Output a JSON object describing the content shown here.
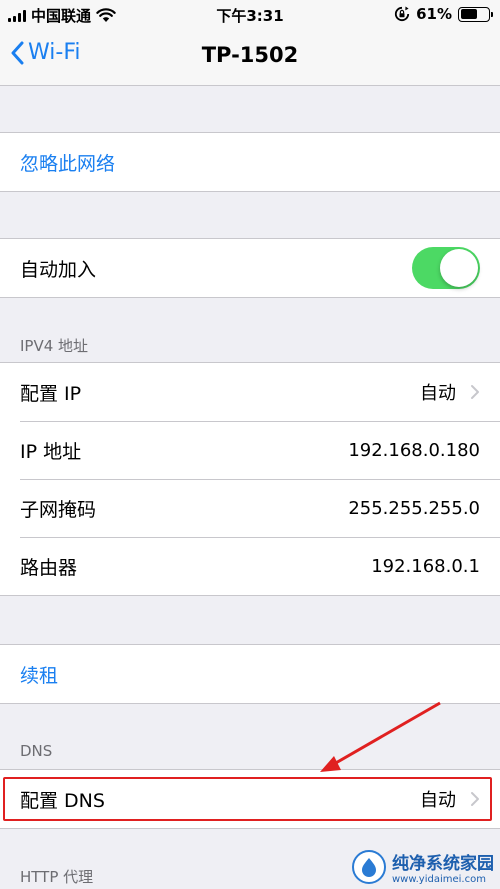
{
  "status_bar": {
    "carrier": "中国联通",
    "time": "下午3:31",
    "battery": "61%",
    "battery_level": 0.61,
    "icons": [
      "signal-icon",
      "wifi-icon",
      "rotation-lock-icon",
      "battery-icon"
    ]
  },
  "nav": {
    "back_label": "Wi-Fi",
    "title": "TP-1502"
  },
  "forget_network": "忽略此网络",
  "auto_join": {
    "label": "自动加入",
    "enabled": true
  },
  "ipv4": {
    "header": "IPV4 地址",
    "rows": [
      {
        "label": "配置 IP",
        "value": "自动"
      },
      {
        "label": "IP 地址",
        "value": "192.168.0.180"
      },
      {
        "label": "子网掩码",
        "value": "255.255.255.0"
      },
      {
        "label": "路由器",
        "value": "192.168.0.1"
      }
    ]
  },
  "renew_lease": "续租",
  "dns": {
    "header": "DNS",
    "configure_label": "配置 DNS",
    "configure_value": "自动"
  },
  "http_proxy": {
    "header": "HTTP 代理"
  },
  "watermark": {
    "title": "纯净系统家园",
    "url": "www.yidaimei.com"
  },
  "colors": {
    "accent": "#1a7ff0",
    "toggle_on": "#4cd964",
    "annotation": "#e02020",
    "background": "#efeff4"
  }
}
